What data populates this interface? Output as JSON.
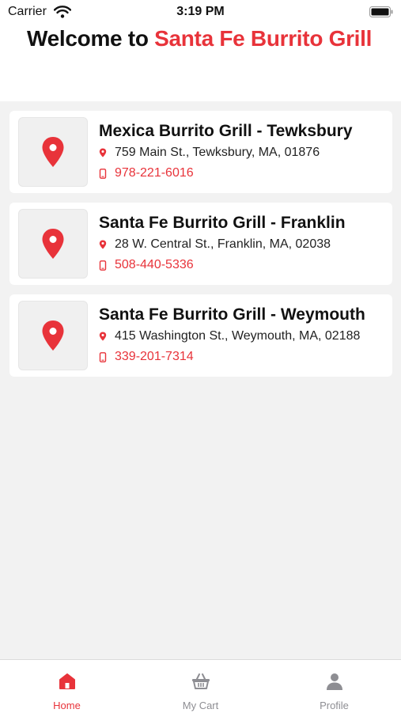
{
  "status_bar": {
    "carrier": "Carrier",
    "time": "3:19 PM"
  },
  "header": {
    "welcome_prefix": "Welcome to ",
    "brand": "Santa Fe Burrito Grill"
  },
  "locations": [
    {
      "name": "Mexica Burrito Grill - Tewksbury",
      "address": "759 Main St., Tewksbury, MA, 01876",
      "phone": "978-221-6016"
    },
    {
      "name": "Santa Fe Burrito Grill - Franklin",
      "address": "28 W. Central St., Franklin, MA, 02038",
      "phone": "508-440-5336"
    },
    {
      "name": "Santa Fe Burrito Grill - Weymouth",
      "address": "415 Washington St., Weymouth, MA, 02188",
      "phone": "339-201-7314"
    }
  ],
  "tabs": [
    {
      "label": "Home",
      "icon": "home-icon",
      "active": true
    },
    {
      "label": "My Cart",
      "icon": "basket-icon",
      "active": false
    },
    {
      "label": "Profile",
      "icon": "person-icon",
      "active": false
    }
  ],
  "colors": {
    "accent": "#e8333a",
    "inactive": "#8e8e93",
    "background": "#f2f2f2"
  }
}
